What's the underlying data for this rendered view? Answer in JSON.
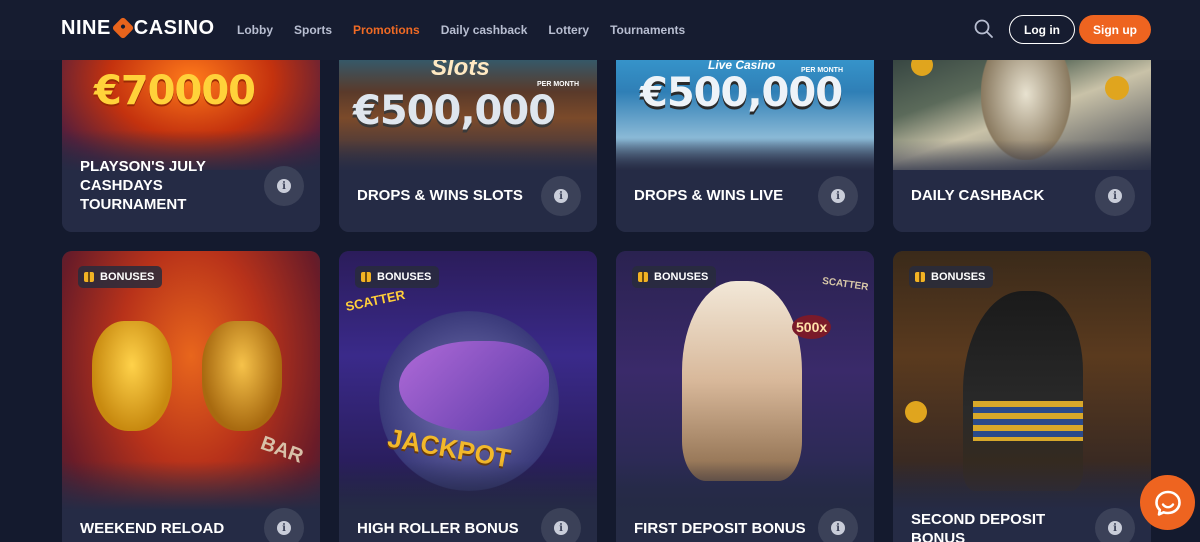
{
  "header": {
    "logo_left": "NINE",
    "logo_right": "CASINO",
    "nav": [
      {
        "label": "Lobby",
        "active": false
      },
      {
        "label": "Sports",
        "active": false
      },
      {
        "label": "Promotions",
        "active": true
      },
      {
        "label": "Daily cashback",
        "active": false
      },
      {
        "label": "Lottery",
        "active": false
      },
      {
        "label": "Tournaments",
        "active": false
      }
    ],
    "login_label": "Log in",
    "signup_label": "Sign up",
    "search_icon": "search-icon"
  },
  "colors": {
    "accent": "#ee6420",
    "background": "#141a2e",
    "card": "#252b45"
  },
  "row1": [
    {
      "title": "PLAYSON'S JULY CASHDAYS TOURNAMENT",
      "img_text": "€70000"
    },
    {
      "title": "DROPS & WINS SLOTS",
      "img_text": "€500,000",
      "img_caption": "Slots",
      "img_sub": "PER MONTH"
    },
    {
      "title": "DROPS & WINS LIVE",
      "img_text": "€500,000",
      "img_caption": "Live Casino",
      "img_sub": "PER MONTH"
    },
    {
      "title": "DAILY CASHBACK"
    }
  ],
  "row2": [
    {
      "badge": "BONUSES",
      "title": "WEEKEND RELOAD",
      "img_text": "BAR"
    },
    {
      "badge": "BONUSES",
      "title": "HIGH ROLLER BONUS",
      "img_text": "JACKPOT",
      "img_caption": "SCATTER"
    },
    {
      "badge": "BONUSES",
      "title": "FIRST DEPOSIT BONUS",
      "img_text": "500x",
      "img_caption": "SCATTER"
    },
    {
      "badge": "BONUSES",
      "title": "SECOND DEPOSIT BONUS"
    }
  ],
  "chat_icon": "chat-bubble-icon"
}
